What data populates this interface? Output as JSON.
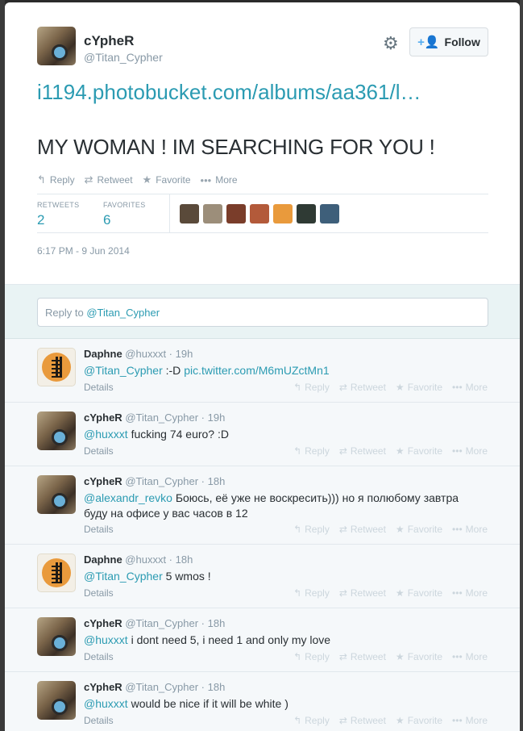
{
  "author": {
    "display_name": "cYpheR",
    "screen_name": "@Titan_Cypher"
  },
  "header": {
    "follow_label": "Follow",
    "gear_glyph": "⚙",
    "follow_glyph": "+👤"
  },
  "tweet": {
    "link": "i1194.photobucket.com/albums/aa361/l…",
    "text": "MY WOMAN ! IM SEARCHING FOR YOU !",
    "timestamp": "6:17 PM - 9 Jun 2014"
  },
  "actions": {
    "reply": "Reply",
    "retweet": "Retweet",
    "favorite": "Favorite",
    "more": "More",
    "reply_glyph": "↰",
    "retweet_glyph": "⇄",
    "favorite_glyph": "★",
    "more_glyph": "•••"
  },
  "stats": {
    "retweets_label": "RETWEETS",
    "retweets_value": "2",
    "favorites_label": "FAVORITES",
    "favorites_value": "6",
    "faces": [
      "#5a4a3a",
      "#9c8e7a",
      "#7a3d2a",
      "#b35a3a",
      "#e99a3c",
      "#2f3a34",
      "#3e5f7a"
    ]
  },
  "reply_box": {
    "prefix": "Reply to ",
    "mention": "@Titan_Cypher"
  },
  "replies": [
    {
      "name": "Daphne",
      "meta": "@huxxxt · 19h",
      "mention": "@Titan_Cypher",
      "text": " :-D ",
      "link": "pic.twitter.com/M6mUZctMn1",
      "details": "Details"
    },
    {
      "name": "cYpheR",
      "meta": "@Titan_Cypher · 19h",
      "mention": "@huxxxt",
      "text": " fucking 74 euro? :D",
      "link": "",
      "details": "Details"
    },
    {
      "name": "cYpheR",
      "meta": "@Titan_Cypher · 18h",
      "mention": "@alexandr_revko",
      "text": " Боюсь, её уже не воскресить))) но я полюбому завтра буду на офисе у вас часов в 12",
      "link": "",
      "details": "Details"
    },
    {
      "name": "Daphne",
      "meta": "@huxxxt · 18h",
      "mention": "@Titan_Cypher",
      "text": " 5 wmos !",
      "link": "",
      "details": "Details"
    },
    {
      "name": "cYpheR",
      "meta": "@Titan_Cypher · 18h",
      "mention": "@huxxxt",
      "text": " i dont need 5, i need 1 and only my love",
      "link": "",
      "details": "Details"
    },
    {
      "name": "cYpheR",
      "meta": "@Titan_Cypher · 18h",
      "mention": "@huxxxt",
      "text": " would be nice if it will be white )",
      "link": "",
      "details": "Details"
    }
  ]
}
